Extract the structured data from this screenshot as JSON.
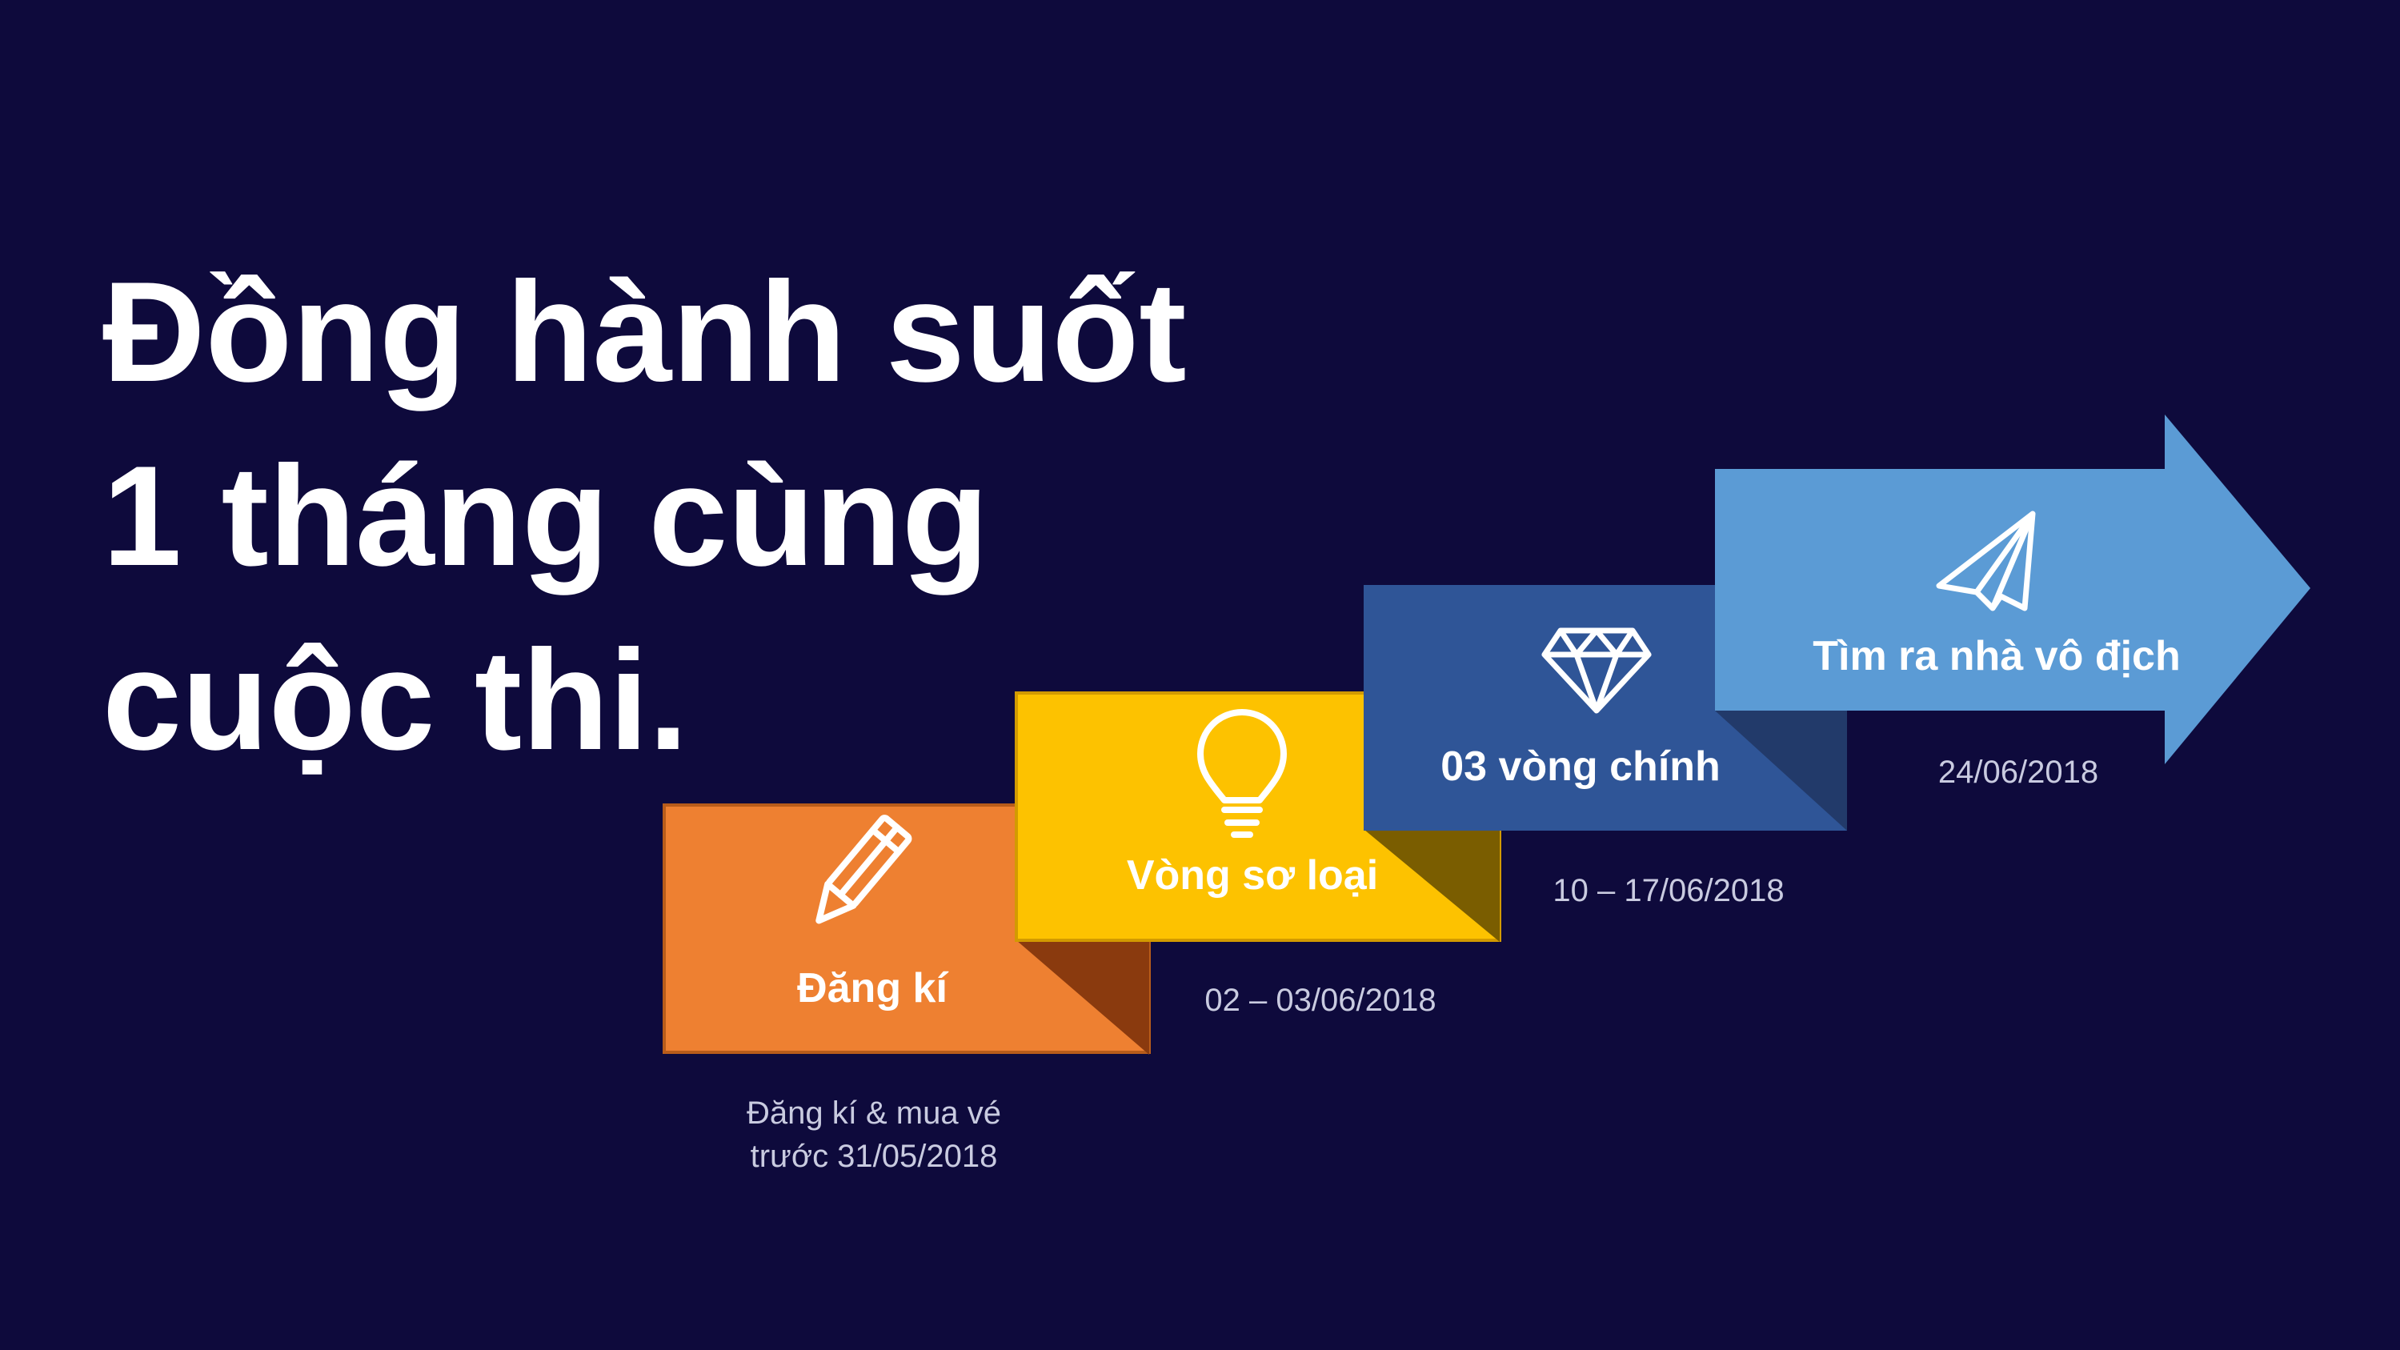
{
  "headline": {
    "line1": "Đồng hành suốt",
    "line2": "1 tháng cùng",
    "line3": "cuộc thi."
  },
  "steps": [
    {
      "label": "Đăng kí",
      "date_line1": "Đăng kí & mua vé",
      "date_line2": "trước 31/05/2018",
      "icon": "pencil-icon",
      "color": "#ee8031"
    },
    {
      "label": "Vòng sơ loại",
      "date_line1": "02 – 03/06/2018",
      "icon": "lightbulb-icon",
      "color": "#fdc200"
    },
    {
      "label": "03 vòng chính",
      "date_line1": "10 – 17/06/2018",
      "icon": "diamond-icon",
      "color": "#2f5597"
    },
    {
      "label": "Tìm ra nhà vô địch",
      "date_line1": "24/06/2018",
      "icon": "paper-plane-icon",
      "color": "#5b9bd5"
    }
  ],
  "colors": {
    "background": "#0e0a3c",
    "text": "#ffffff",
    "date_text": "#c9cbe0"
  }
}
